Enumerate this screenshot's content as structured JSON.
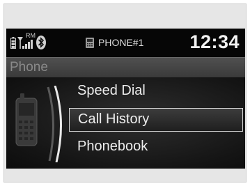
{
  "status": {
    "roaming_label": "RM",
    "phone_name": "PHONE#1",
    "time": "12:34",
    "icons": [
      "battery-icon",
      "signal-icon",
      "bluetooth-icon",
      "phone-device-icon"
    ]
  },
  "screen": {
    "title": "Phone"
  },
  "menu": {
    "items": [
      {
        "label": "Speed Dial"
      },
      {
        "label": "Call History",
        "selected": true
      },
      {
        "label": "Phonebook"
      }
    ]
  }
}
